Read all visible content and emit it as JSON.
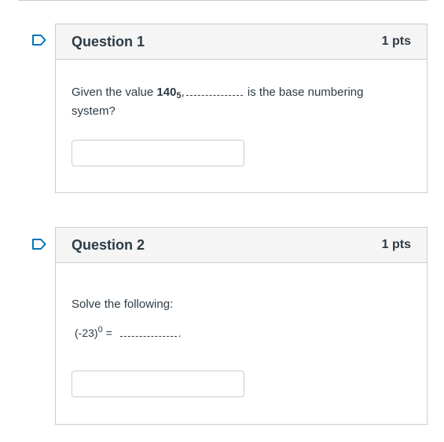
{
  "questions": [
    {
      "title": "Question 1",
      "points": "1 pts",
      "text_prefix": "Given the value ",
      "value_bold": "140",
      "value_sub": "5",
      "text_middle": ",",
      "text_suffix": "is the base numbering",
      "text_line2": "system?",
      "answer_value": ""
    },
    {
      "title": "Question 2",
      "points": "1 pts",
      "instruction": "Solve the following:",
      "expr_base": "(-23)",
      "expr_exp": "0",
      "expr_eq": " =",
      "expr_end": ".",
      "answer_value": ""
    }
  ],
  "colors": {
    "accent": "#0374b5",
    "border": "#c7cdd1",
    "header_bg": "#f5f5f5",
    "text": "#2d3b45"
  },
  "icons": {
    "flag": "bookmark-flag-icon"
  }
}
